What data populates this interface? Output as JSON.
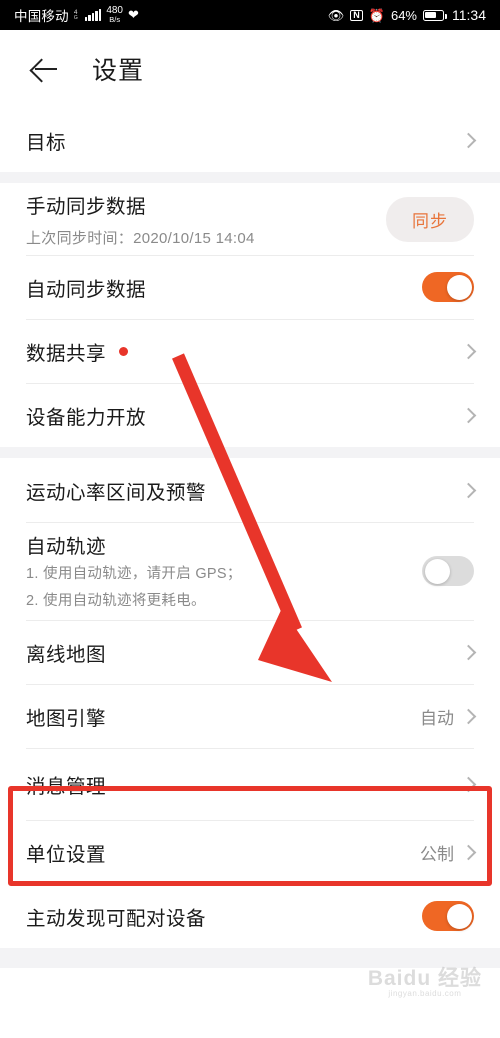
{
  "statusbar": {
    "carrier": "中国移动",
    "network_type": "4G",
    "data_rate_value": "480",
    "data_rate_unit": "B/s",
    "heart_icon": "heart-rate-icon",
    "eye_icon": "eye-comfort-icon",
    "nfc_label": "N",
    "alarm_icon": "alarm-clock-icon",
    "battery_percent": "64%",
    "time": "11:34"
  },
  "header": {
    "back_icon": "back-arrow-icon",
    "title": "设置"
  },
  "sections": [
    {
      "rows": [
        {
          "title": "目标",
          "type": "link"
        }
      ]
    },
    {
      "rows": [
        {
          "title": "手动同步数据",
          "subtitle": "上次同步时间：2020/10/15 14:04",
          "type": "button",
          "button_label": "同步"
        },
        {
          "title": "自动同步数据",
          "type": "toggle",
          "toggle_state": "on"
        },
        {
          "title": "数据共享",
          "type": "link",
          "badge": true
        },
        {
          "title": "设备能力开放",
          "type": "link"
        }
      ]
    },
    {
      "rows": [
        {
          "title": "运动心率区间及预警",
          "type": "link"
        },
        {
          "title": "自动轨迹",
          "subtitle_1": "1. 使用自动轨迹，请开启 GPS；",
          "subtitle_2": "2. 使用自动轨迹将更耗电。",
          "type": "toggle",
          "toggle_state": "off"
        },
        {
          "title": "离线地图",
          "type": "link"
        },
        {
          "title": "地图引擎",
          "type": "link",
          "value": "自动"
        },
        {
          "title": "消息管理",
          "type": "link",
          "highlighted": true
        },
        {
          "title": "单位设置",
          "type": "link",
          "value": "公制"
        },
        {
          "title": "主动发现可配对设备",
          "type": "toggle",
          "toggle_state": "on"
        }
      ]
    }
  ],
  "annotations": {
    "arrow_color": "#e8352a",
    "box_color": "#e8352a",
    "arrow_target": "消息管理"
  },
  "watermark": {
    "text": "Baidu 经验",
    "sub": "jingyan.baidu.com"
  }
}
